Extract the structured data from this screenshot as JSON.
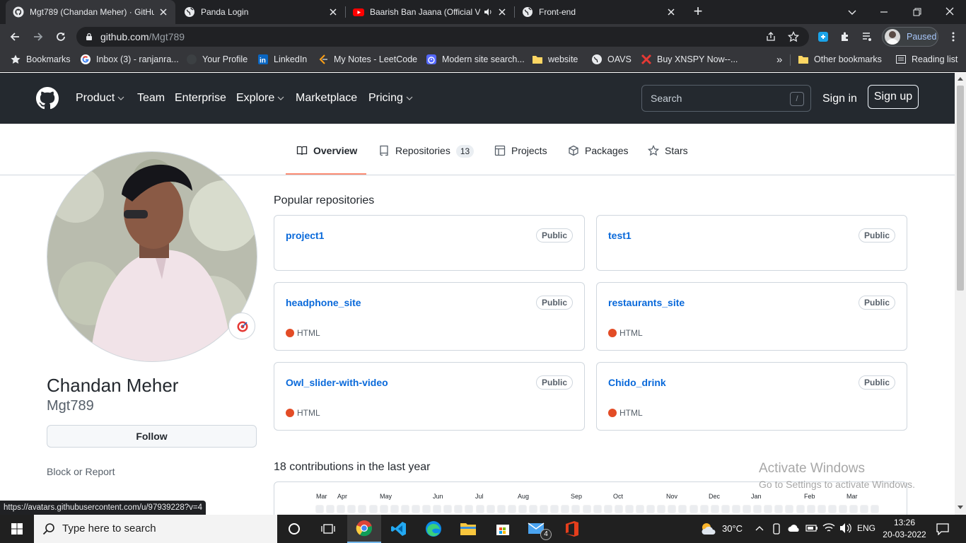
{
  "browser": {
    "tabs": [
      {
        "title": "Mgt789 (Chandan Meher) · GitHu",
        "icon": "github-icon",
        "active": true
      },
      {
        "title": "Panda Login",
        "icon": "globe-icon",
        "active": false
      },
      {
        "title": "Baarish Ban Jaana (Official Vi",
        "icon": "youtube-icon",
        "active": false
      },
      {
        "title": "Front-end",
        "icon": "globe-icon",
        "active": false
      }
    ],
    "new_tab": "+",
    "url_domain": "github.com",
    "url_path": "/Mgt789",
    "profile_status": "Paused",
    "bookmarks": [
      {
        "label": "Bookmarks",
        "icon": "star-icon"
      },
      {
        "label": "Inbox (3) - ranjanra...",
        "icon": "google-icon"
      },
      {
        "label": "Your Profile",
        "icon": "github-icon"
      },
      {
        "label": "LinkedIn",
        "icon": "linkedin-icon"
      },
      {
        "label": "My Notes - LeetCode",
        "icon": "leetcode-icon"
      },
      {
        "label": "Modern site search...",
        "icon": "stopwatch-icon"
      },
      {
        "label": "website",
        "icon": "folder-icon"
      },
      {
        "label": "OAVS",
        "icon": "globe-icon"
      },
      {
        "label": "Buy XNSPY Now--...",
        "icon": "x-logo-icon"
      }
    ],
    "more_bookmarks": "»",
    "other_bookmarks": "Other bookmarks",
    "reading_list": "Reading list",
    "status_url": "https://avatars.githubusercontent.com/u/97939228?v=4"
  },
  "github": {
    "nav": [
      "Product",
      "Team",
      "Enterprise",
      "Explore",
      "Marketplace",
      "Pricing"
    ],
    "search_placeholder": "Search",
    "search_shortcut": "/",
    "sign_in": "Sign in",
    "sign_up": "Sign up",
    "profile_tabs": [
      {
        "label": "Overview",
        "icon": "book-icon"
      },
      {
        "label": "Repositories",
        "icon": "repo-icon",
        "count": "13"
      },
      {
        "label": "Projects",
        "icon": "table-icon"
      },
      {
        "label": "Packages",
        "icon": "package-icon"
      },
      {
        "label": "Stars",
        "icon": "star-icon"
      }
    ],
    "profile": {
      "full_name": "Chandan Meher",
      "username": "Mgt789",
      "follow": "Follow",
      "block_report": "Block or Report"
    },
    "popular_title": "Popular repositories",
    "repos": [
      {
        "name": "project1",
        "visibility": "Public",
        "language": ""
      },
      {
        "name": "test1",
        "visibility": "Public",
        "language": ""
      },
      {
        "name": "headphone_site",
        "visibility": "Public",
        "language": "HTML"
      },
      {
        "name": "restaurants_site",
        "visibility": "Public",
        "language": "HTML"
      },
      {
        "name": "Owl_slider-with-video",
        "visibility": "Public",
        "language": "HTML"
      },
      {
        "name": "Chido_drink",
        "visibility": "Public",
        "language": "HTML"
      }
    ],
    "html_color": "#e34c26",
    "contributions_title": "18 contributions in the last year",
    "months": [
      "Mar",
      "Apr",
      "May",
      "Jun",
      "Jul",
      "Aug",
      "Sep",
      "Oct",
      "Nov",
      "Dec",
      "Jan",
      "Feb",
      "Mar"
    ]
  },
  "windows": {
    "activate_title": "Activate Windows",
    "activate_sub": "Go to Settings to activate Windows.",
    "search_placeholder": "Type here to search",
    "weather": "30°C",
    "language": "ENG",
    "time": "13:26",
    "date": "20-03-2022",
    "mail_badge": "4"
  },
  "colors": {
    "accent_underline": "#fd8c73",
    "link": "#0969da",
    "header_bg": "#24292f"
  }
}
